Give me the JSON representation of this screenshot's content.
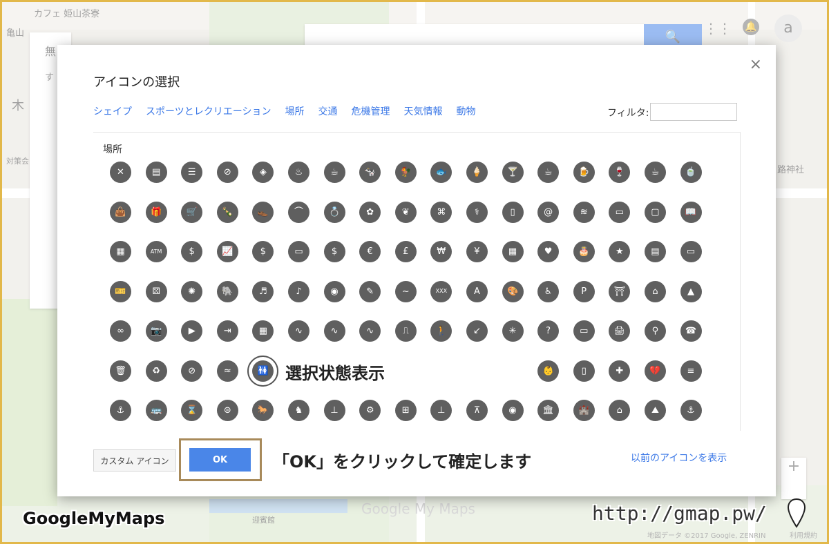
{
  "map": {
    "labels": [
      "カフェ 姫山茶寮",
      "亀山",
      "無",
      "す",
      "木",
      "対策会",
      "路神社",
      "迎賓館"
    ],
    "watermark": "Google My Maps",
    "copyright": "地図データ ©2017 Google, ZENRIN",
    "terms": "利用規約"
  },
  "header": {
    "search_icon": "🔍",
    "apps_icon": "⋮⋮",
    "bell_icon": "🔔",
    "avatar_text": "a"
  },
  "dialog": {
    "title": "アイコンの選択",
    "close": "×",
    "tabs": [
      "シェイプ",
      "スポーツとレクリエーション",
      "場所",
      "交通",
      "危機管理",
      "天気情報",
      "動物"
    ],
    "filter_label": "フィルタ:",
    "filter_value": "",
    "section_title": "場所",
    "selected_index": 89,
    "icons": [
      "✕",
      "▤",
      "☰",
      "⊘",
      "◈",
      "♨",
      "☕",
      "🐄",
      "🐓",
      "🐟",
      "🍦",
      "🍸",
      "☕",
      "🍺",
      "🍷",
      "☕",
      "🍵",
      "👜",
      "🎁",
      "🛒",
      "🍾",
      "👞",
      "⌒",
      "💍",
      "✿",
      "❦",
      "⌘",
      "⚕",
      "▯",
      "@",
      "≋",
      "▭",
      "▢",
      "📖",
      "▦",
      "ATM",
      "$",
      "📈",
      "$",
      "▭",
      "$",
      "€",
      "£",
      "₩",
      "¥",
      "▦",
      "♥",
      "🎂",
      "★",
      "▤",
      "▭",
      "🎫",
      "⚄",
      "✺",
      "🐘",
      "♬",
      "♪",
      "◉",
      "✎",
      "~",
      "XXX",
      "A",
      "🎨",
      "♿",
      "P",
      "⛩",
      "⌂",
      "▲",
      "∞",
      "📷",
      "▶",
      "⇥",
      "▦",
      "∿",
      "∿",
      "∿",
      "⎍",
      "🚶",
      "↙",
      "✳",
      "?",
      "▭",
      "🖨",
      "⚲",
      "☎",
      "🗑",
      "♻",
      "⊘",
      "≈",
      "🚻",
      "",
      "",
      "",
      "",
      "",
      "",
      "",
      "👶",
      "▯",
      "✚",
      "💔",
      "≡",
      "⚓",
      "🚌",
      "⌛",
      "⊜",
      "🐎",
      "♞",
      "⊥",
      "⚙",
      "⊞",
      "⊥",
      "⊼",
      "◉",
      "🏛",
      "🏰",
      "⌂",
      "⛰",
      "⚓",
      "((•))",
      "✺",
      "☀"
    ],
    "custom_button": "カスタム アイコン",
    "ok_button": "OK",
    "prev_link": "以前のアイコンを表示"
  },
  "annotations": {
    "selected_callout": "選択状態表示",
    "ok_callout": "「OK」をクリックして確定します",
    "brand": "GoogleMyMaps",
    "url": "http://gmap.pw/"
  }
}
